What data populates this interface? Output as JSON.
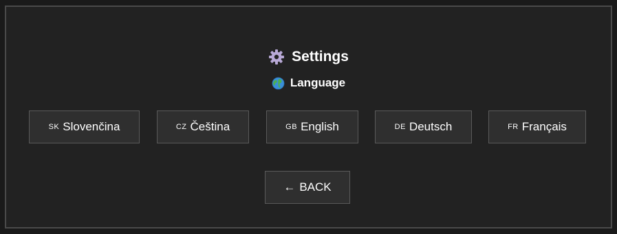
{
  "header": {
    "title": "Settings",
    "title_icon": "gear-icon"
  },
  "section": {
    "label": "Language",
    "icon": "globe-icon"
  },
  "languages": [
    {
      "code": "SK",
      "label": "Slovenčina"
    },
    {
      "code": "CZ",
      "label": "Čeština"
    },
    {
      "code": "GB",
      "label": "English"
    },
    {
      "code": "DE",
      "label": "Deutsch"
    },
    {
      "code": "FR",
      "label": "Français"
    }
  ],
  "back_button": {
    "arrow": "←",
    "label": "BACK"
  },
  "colors": {
    "background": "#222222",
    "border": "#4a4a4a",
    "button_bg": "#2f2f2f",
    "button_border": "#5a5a5a",
    "text": "#ffffff"
  }
}
